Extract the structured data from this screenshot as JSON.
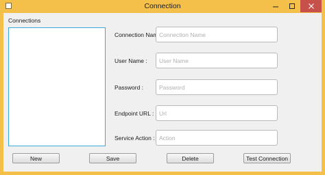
{
  "window": {
    "title": "Connection"
  },
  "titlebar_icons": {
    "minimize": "minimize-icon",
    "maximize": "maximize-icon",
    "close": "close-icon"
  },
  "connections": {
    "label": "Connections",
    "items": []
  },
  "form": {
    "connection_name": {
      "label": "Connection Name :",
      "value": "",
      "placeholder": "Connection Name"
    },
    "user_name": {
      "label": "User Name :",
      "value": "",
      "placeholder": "User Name"
    },
    "password": {
      "label": "Password :",
      "value": "",
      "placeholder": "Password"
    },
    "endpoint_url": {
      "label": "Endpoint URL :",
      "value": "",
      "placeholder": "Url"
    },
    "service_action": {
      "label": "Service Action :",
      "value": "",
      "placeholder": "Action"
    }
  },
  "buttons": {
    "new": "New",
    "save": "Save",
    "delete": "Delete",
    "test_connection": "Test Connection"
  },
  "colors": {
    "title_bar": "#f5c04a",
    "close_button": "#c7504a",
    "list_border": "#39a9dc",
    "panel": "#f0f0f0"
  }
}
